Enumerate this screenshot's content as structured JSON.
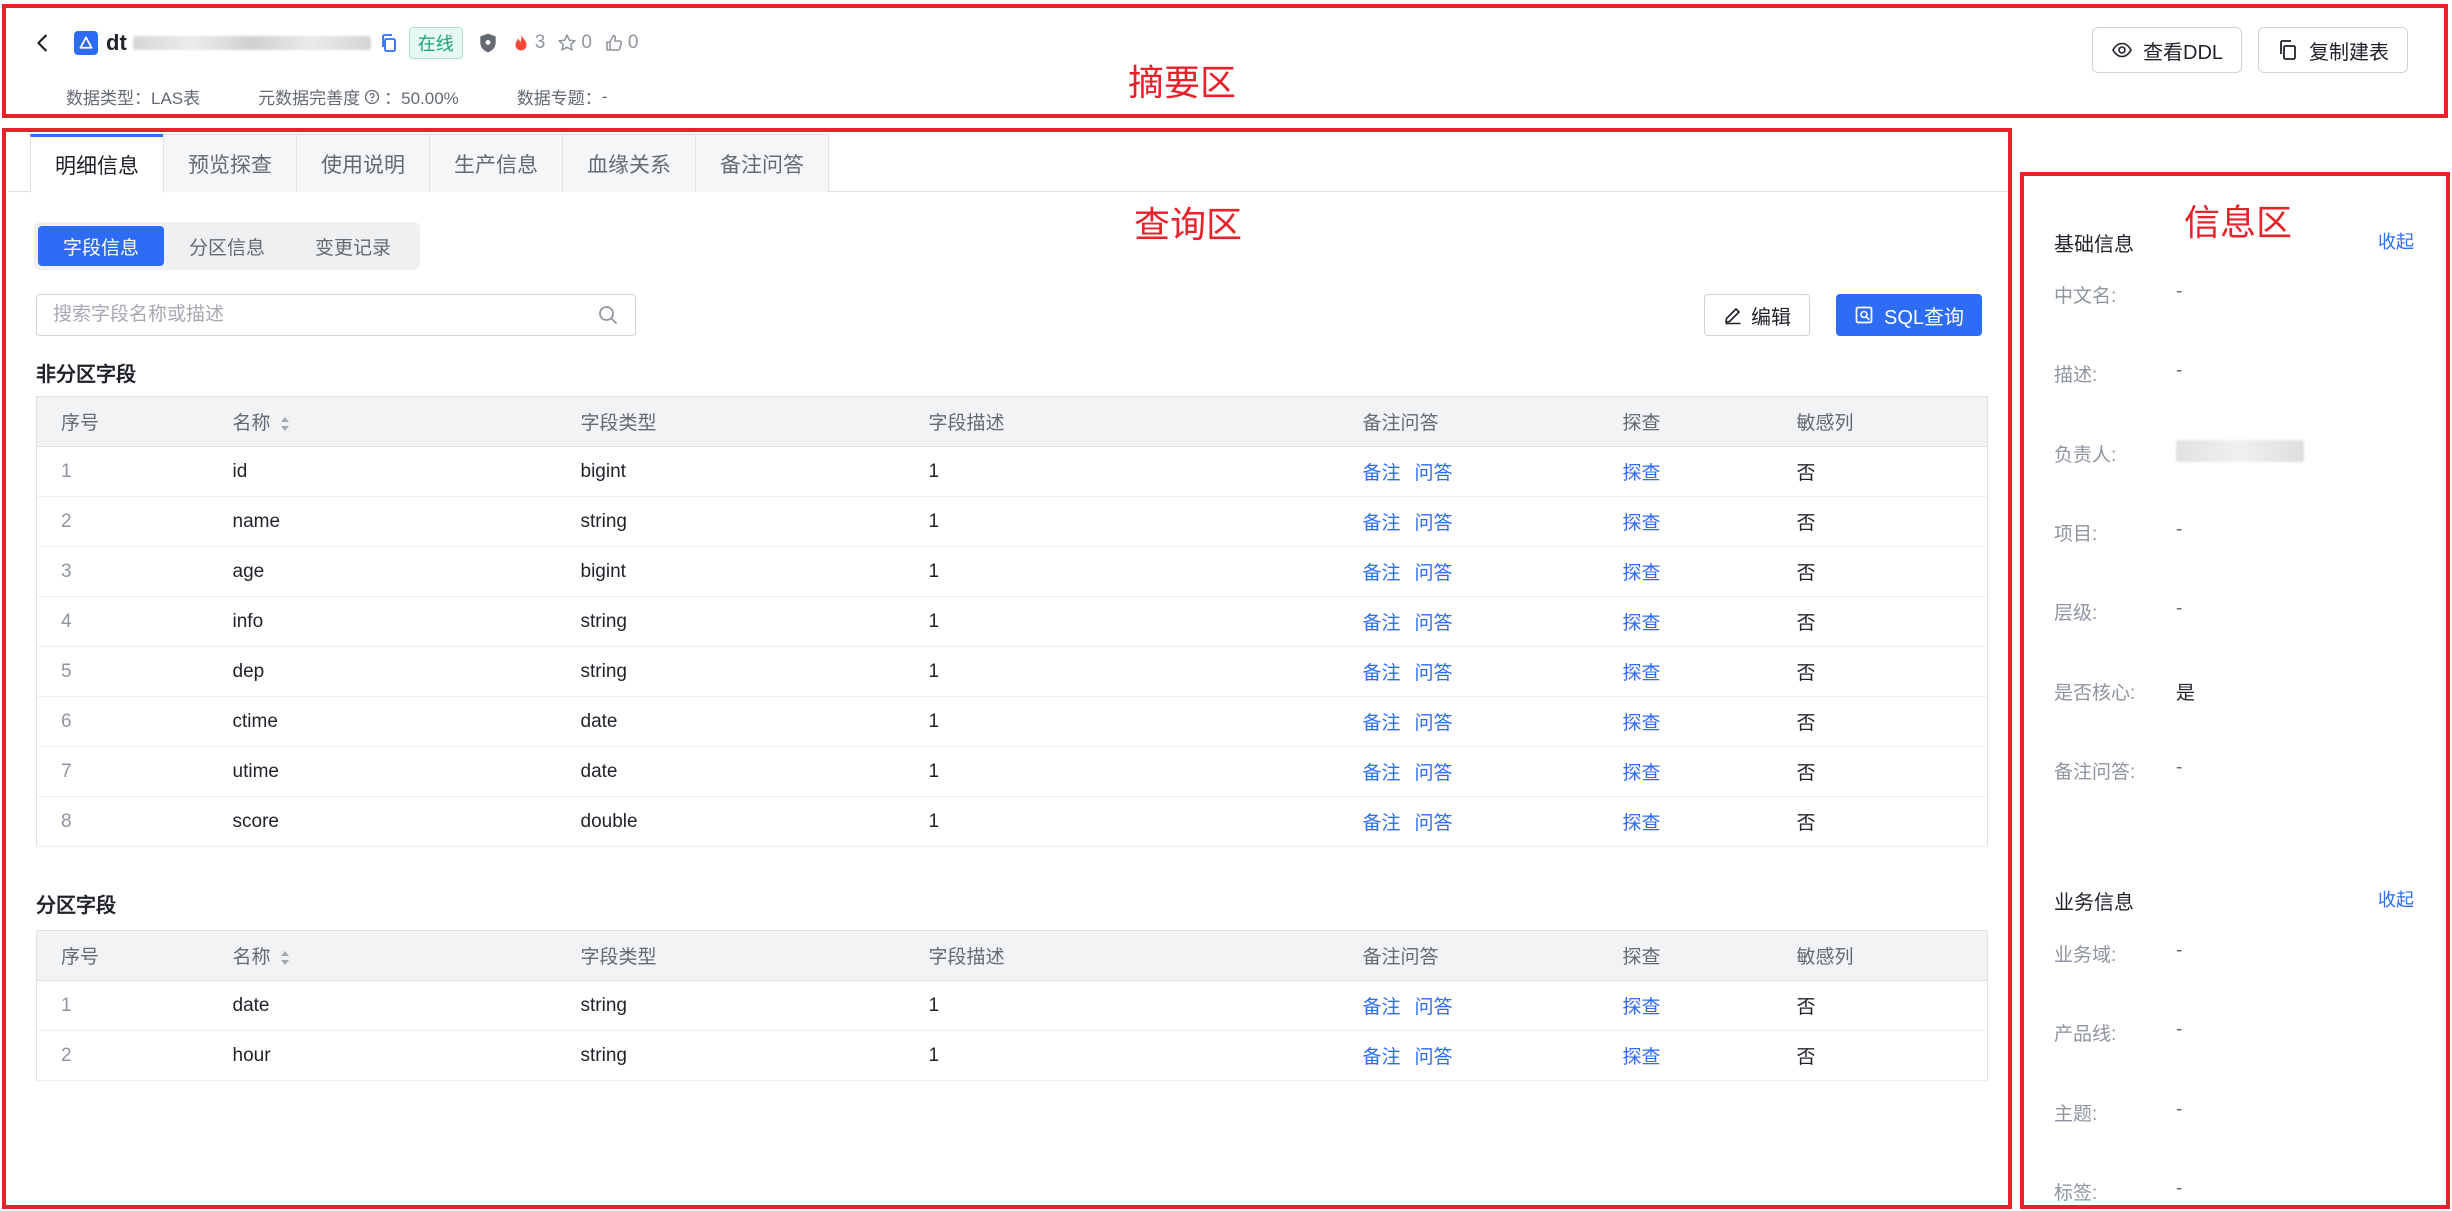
{
  "header": {
    "title_prefix": "dt",
    "status_badge": "在线",
    "heat_count": "3",
    "star_count": "0",
    "like_count": "0",
    "meta": {
      "data_type_label": "数据类型：",
      "data_type_value": "LAS表",
      "completeness_label": "元数据完善度",
      "completeness_value": "：50.00%",
      "topic_label": "数据专题：",
      "topic_value": "-"
    },
    "view_ddl_label": "查看DDL",
    "copy_table_label": "复制建表"
  },
  "annotations": {
    "summary": "摘要区",
    "query": "查询区",
    "info": "信息区"
  },
  "tabs": [
    "明细信息",
    "预览探查",
    "使用说明",
    "生产信息",
    "血缘关系",
    "备注问答"
  ],
  "subtabs": [
    "字段信息",
    "分区信息",
    "变更记录"
  ],
  "search": {
    "placeholder": "搜索字段名称或描述"
  },
  "toolbar": {
    "edit_label": "编辑",
    "sql_label": "SQL查询"
  },
  "non_partition": {
    "title": "非分区字段",
    "columns": [
      "序号",
      "名称",
      "字段类型",
      "字段描述",
      "备注问答",
      "探查",
      "敏感列"
    ],
    "rows": [
      {
        "idx": "1",
        "name": "id",
        "type": "bigint",
        "desc": "1",
        "remark": "备注",
        "qa": "问答",
        "probe": "探查",
        "sensitive": "否"
      },
      {
        "idx": "2",
        "name": "name",
        "type": "string",
        "desc": "1",
        "remark": "备注",
        "qa": "问答",
        "probe": "探查",
        "sensitive": "否"
      },
      {
        "idx": "3",
        "name": "age",
        "type": "bigint",
        "desc": "1",
        "remark": "备注",
        "qa": "问答",
        "probe": "探查",
        "sensitive": "否"
      },
      {
        "idx": "4",
        "name": "info",
        "type": "string",
        "desc": "1",
        "remark": "备注",
        "qa": "问答",
        "probe": "探查",
        "sensitive": "否"
      },
      {
        "idx": "5",
        "name": "dep",
        "type": "string",
        "desc": "1",
        "remark": "备注",
        "qa": "问答",
        "probe": "探查",
        "sensitive": "否"
      },
      {
        "idx": "6",
        "name": "ctime",
        "type": "date",
        "desc": "1",
        "remark": "备注",
        "qa": "问答",
        "probe": "探查",
        "sensitive": "否"
      },
      {
        "idx": "7",
        "name": "utime",
        "type": "date",
        "desc": "1",
        "remark": "备注",
        "qa": "问答",
        "probe": "探查",
        "sensitive": "否"
      },
      {
        "idx": "8",
        "name": "score",
        "type": "double",
        "desc": "1",
        "remark": "备注",
        "qa": "问答",
        "probe": "探查",
        "sensitive": "否"
      }
    ]
  },
  "partition": {
    "title": "分区字段",
    "columns": [
      "序号",
      "名称",
      "字段类型",
      "字段描述",
      "备注问答",
      "探查",
      "敏感列"
    ],
    "rows": [
      {
        "idx": "1",
        "name": "date",
        "type": "string",
        "desc": "1",
        "remark": "备注",
        "qa": "问答",
        "probe": "探查",
        "sensitive": "否"
      },
      {
        "idx": "2",
        "name": "hour",
        "type": "string",
        "desc": "1",
        "remark": "备注",
        "qa": "问答",
        "probe": "探查",
        "sensitive": "否"
      }
    ]
  },
  "basic_info": {
    "title": "基础信息",
    "collapse_label": "收起",
    "rows": [
      {
        "k": "中文名:",
        "v": "-"
      },
      {
        "k": "描述:",
        "v": "-"
      },
      {
        "k": "负责人:",
        "v": ""
      },
      {
        "k": "项目:",
        "v": "-"
      },
      {
        "k": "层级:",
        "v": "-"
      },
      {
        "k": "是否核心:",
        "v": "是"
      },
      {
        "k": "备注问答:",
        "v": "-"
      }
    ]
  },
  "business_info": {
    "title": "业务信息",
    "collapse_label": "收起",
    "rows": [
      {
        "k": "业务域:",
        "v": "-"
      },
      {
        "k": "产品线:",
        "v": "-"
      },
      {
        "k": "主题:",
        "v": "-"
      },
      {
        "k": "标签:",
        "v": "-"
      }
    ]
  },
  "colors": {
    "accent": "#2e6cf5",
    "annotation_red": "#e8222b",
    "online_green": "#1aa37a"
  }
}
